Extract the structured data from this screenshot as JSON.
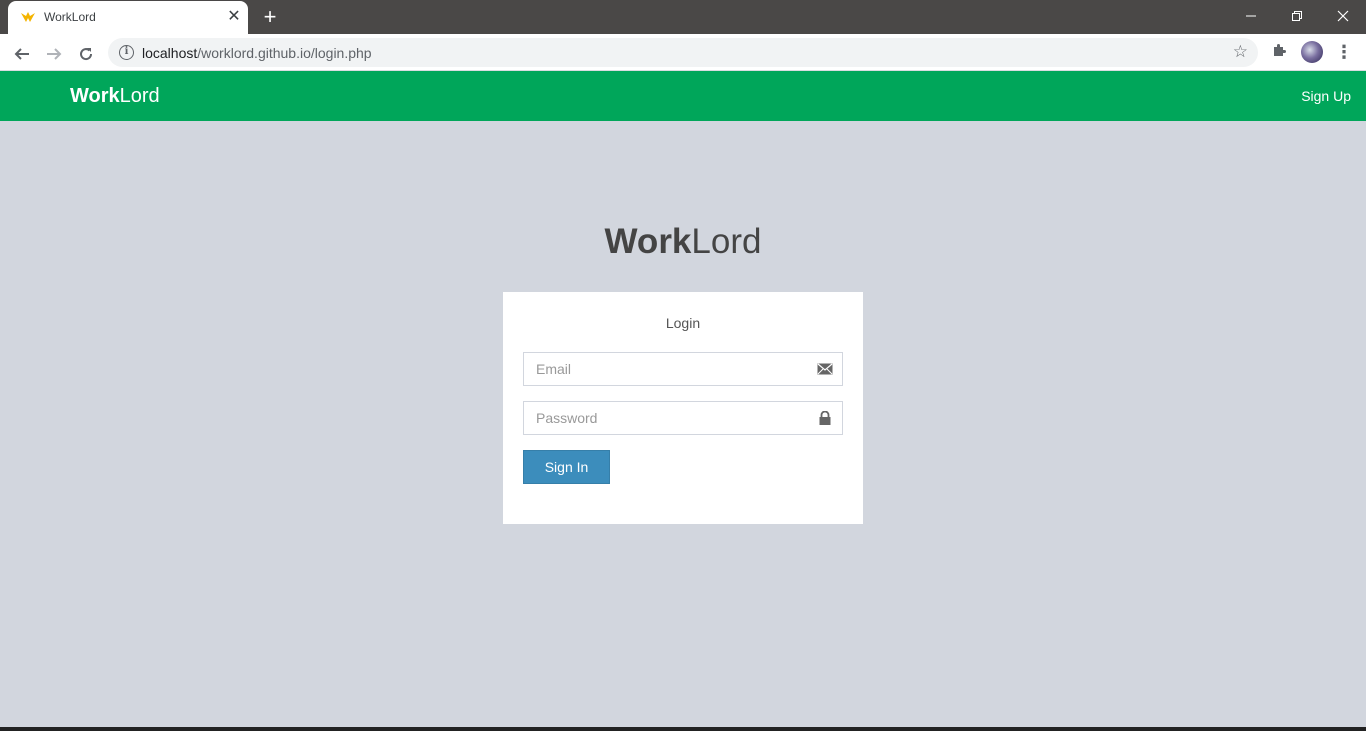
{
  "browser": {
    "tab_title": "WorkLord",
    "tab_close": "✕",
    "new_tab": "+",
    "url_host": "localhost",
    "url_path": "/worklord.github.io/login.php"
  },
  "header": {
    "logo_bold": "Work",
    "logo_rest": "Lord",
    "signup_label": "Sign Up"
  },
  "login": {
    "logo_bold": "Work",
    "logo_rest": "Lord",
    "message": "Login",
    "email_placeholder": "Email",
    "email_value": "",
    "password_placeholder": "Password",
    "password_value": "",
    "signin_label": "Sign In"
  },
  "colors": {
    "header_green": "#00a65a",
    "page_bg": "#d2d6de",
    "button_blue": "#3c8dbc"
  },
  "icons": {
    "email_field": "envelope-icon",
    "password_field": "lock-icon"
  }
}
